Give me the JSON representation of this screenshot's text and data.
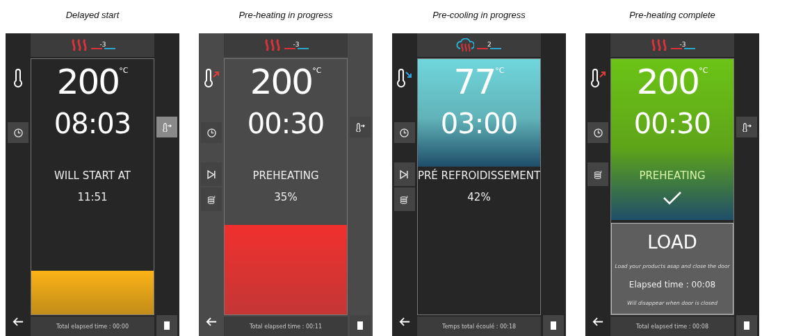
{
  "panels": [
    {
      "caption": "Delayed start",
      "color": "#262626",
      "heater": {
        "kind": "heat",
        "value": "-3"
      },
      "temp_rising": false,
      "temp_falling": false,
      "temperature": "200",
      "unit": "°C",
      "time": "08:03",
      "status": "WILL START AT",
      "detail": "11:51",
      "complete": false,
      "fill": {
        "level": 0.17,
        "kind": "bottom",
        "color": "#fbb216"
      },
      "right_button": {
        "selected": true
      },
      "footer": "Total elapsed time : 00:00"
    },
    {
      "caption": "Pre-heating in progress",
      "color": "#4a4a4a",
      "heater": {
        "kind": "heat",
        "value": "-3"
      },
      "temp_rising": true,
      "temp_falling": false,
      "temperature": "200",
      "unit": "°C",
      "time": "00:30",
      "status": "PREHEATING",
      "detail": "35%",
      "complete": false,
      "fill": {
        "level": 0.35,
        "kind": "bottom",
        "color": "#f0302e"
      },
      "left_buttons": [
        {
          "kind": "skip"
        },
        {
          "kind": "stack"
        }
      ],
      "right_button": {
        "selected": false
      },
      "footer": "Total elapsed time : 00:11"
    },
    {
      "caption": "Pre-cooling in progress",
      "color": "#262626",
      "heater": {
        "kind": "cool",
        "value": "2"
      },
      "temp_rising": false,
      "temp_falling": true,
      "temperature": "77",
      "unit": "°C",
      "time": "03:00",
      "status": "PRÉ REFROIDISSEMENT",
      "detail": "42%",
      "complete": false,
      "fill": {
        "level": 0.42,
        "kind": "top",
        "color": "#6fd6dc"
      },
      "left_buttons": [
        {
          "kind": "skip"
        },
        {
          "kind": "stack"
        }
      ],
      "footer": "Temps total écoulé : 00:18"
    },
    {
      "caption": "Pre-heating complete",
      "color": "#262626",
      "heater": {
        "kind": "heat",
        "value": "-3"
      },
      "temp_rising": true,
      "temp_falling": false,
      "temperature": "200",
      "unit": "°C",
      "time": "00:30",
      "status": "PREHEATING",
      "complete": true,
      "fill": {
        "level": 0.63,
        "kind": "top",
        "color": "#6cc416"
      },
      "left_buttons": [
        {
          "kind": "stack"
        }
      ],
      "right_button": {
        "selected": false
      },
      "load": {
        "title": "LOAD",
        "hint": "Load your products asap and close the door",
        "elapsed": "Elapsed time : 00:08",
        "note": "Will disappear when door is closed"
      },
      "footer": "Total elapsed time : 00:08"
    }
  ]
}
